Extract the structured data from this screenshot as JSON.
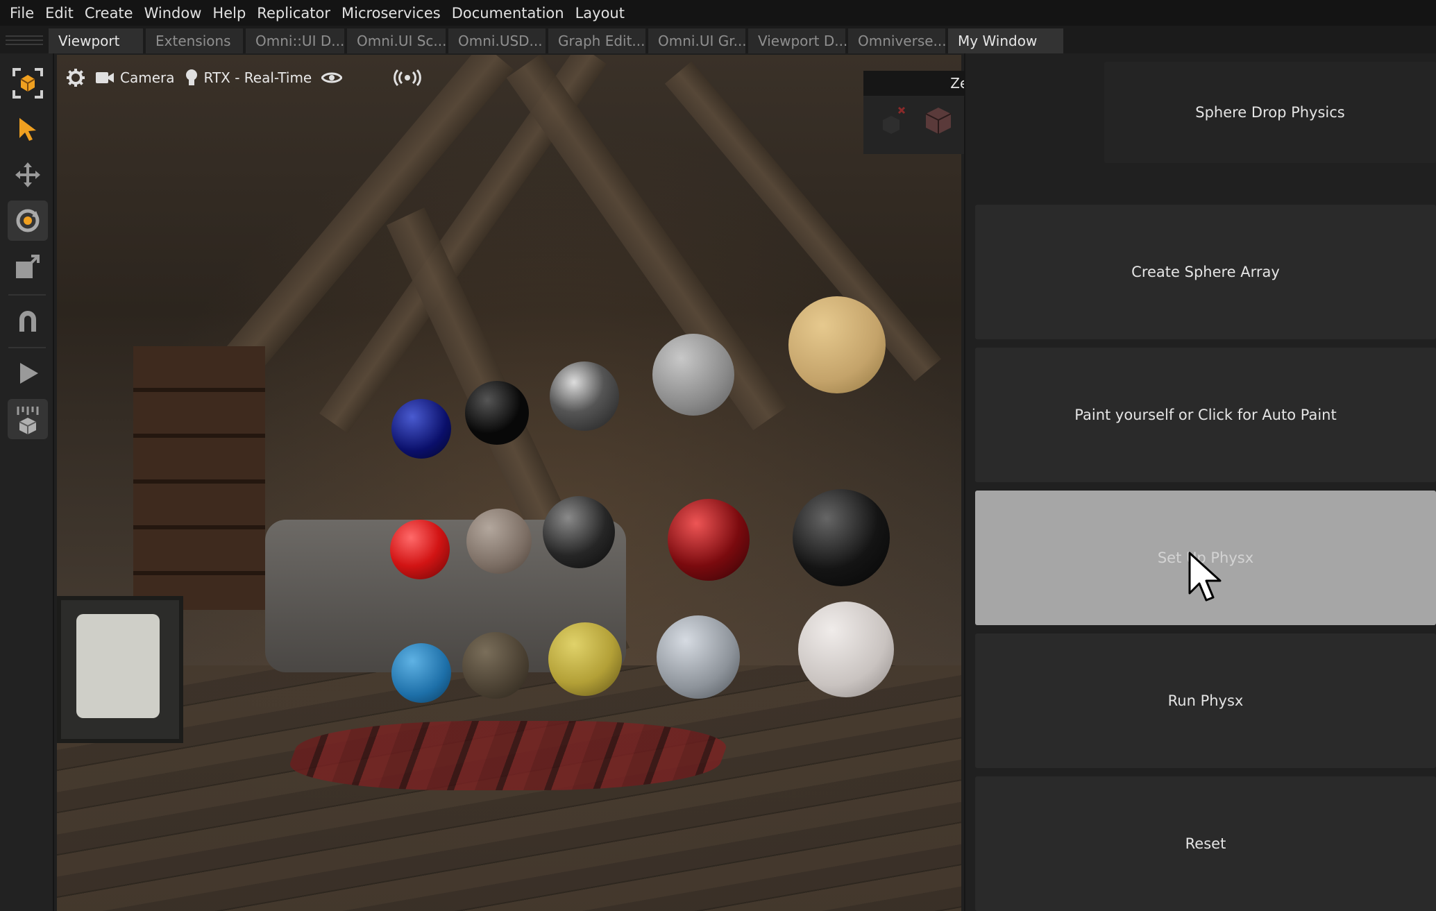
{
  "menubar": {
    "items": [
      "File",
      "Edit",
      "Create",
      "Window",
      "Help",
      "Replicator",
      "Microservices",
      "Documentation",
      "Layout"
    ]
  },
  "tabs": {
    "items": [
      "Viewport",
      "Extensions",
      "Omni::UI D...",
      "Omni.UI Sc...",
      "Omni.USD...",
      "Graph Edit...",
      "Omni.UI Gr...",
      "Viewport D...",
      "Omniverse...",
      "My Window"
    ]
  },
  "toolbar": {
    "tools": [
      "scene-select-icon",
      "select-arrow-icon",
      "move-icon",
      "rotate-icon",
      "scale-icon",
      "snap-magnet-icon",
      "play-icon",
      "physics-drop-icon"
    ]
  },
  "viewport": {
    "settings_icon": "gear-icon",
    "camera_label": "Camera",
    "renderer_label": "RTX - Real-Time",
    "visibility_icon": "eye-icon",
    "live_icon": "broadcast-icon"
  },
  "zero_gravity": {
    "title": "Zero Gravity",
    "icons": [
      "clear-marker-icon",
      "dynamic-cube-icon",
      "static-cube-icon",
      "simulate-icon",
      "menu-icon"
    ]
  },
  "panel": {
    "buttons": [
      {
        "label": "Sphere Drop Physics"
      },
      {
        "label": "Create Sphere Array"
      },
      {
        "label": "Paint yourself or Click for Auto Paint"
      },
      {
        "label": "Set Up Physx"
      },
      {
        "label": "Run Physx"
      },
      {
        "label": "Reset"
      }
    ]
  },
  "colors": {
    "accent_orange": "#f0a020",
    "hover_button": "#a6a6a6",
    "panel_bg": "#202020"
  }
}
